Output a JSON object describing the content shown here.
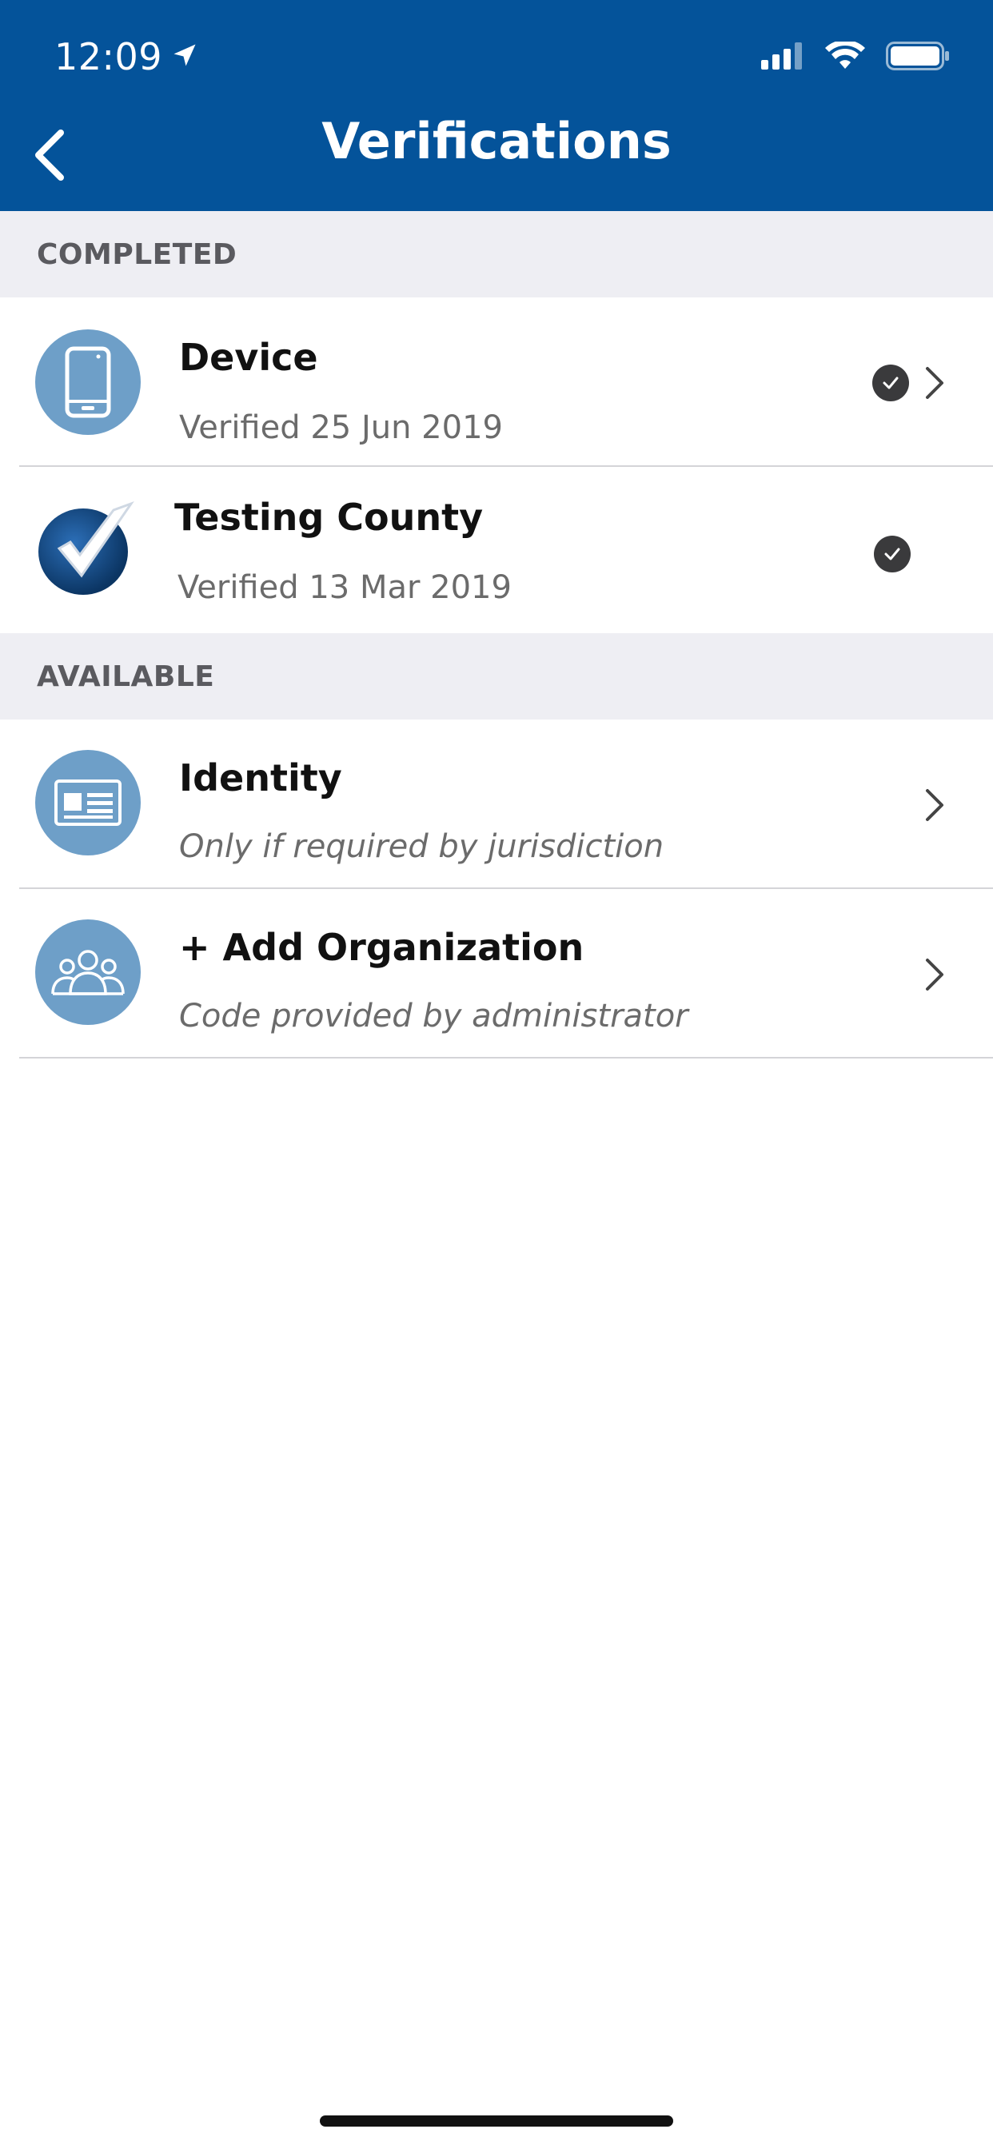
{
  "status_bar": {
    "time": "12:09"
  },
  "nav": {
    "title": "Verifications"
  },
  "sections": {
    "completed_label": "COMPLETED",
    "available_label": "AVAILABLE"
  },
  "completed_items": [
    {
      "title": "Device",
      "subtitle": "Verified 25 Jun 2019",
      "icon": "phone-icon"
    },
    {
      "title": "Testing County",
      "subtitle": "Verified 13 Mar 2019",
      "icon": "checkmark-logo-icon"
    }
  ],
  "available_items": [
    {
      "title": "Identity",
      "subtitle": "Only if required by jurisdiction",
      "icon": "id-card-icon"
    },
    {
      "title": "+ Add Organization",
      "subtitle": "Code provided by administrator",
      "icon": "group-icon"
    }
  ],
  "colors": {
    "header": "#04539A",
    "icon_circle": "#6E9FC8",
    "section_bg": "#EEEEF3",
    "badge": "#3A3A3C"
  }
}
